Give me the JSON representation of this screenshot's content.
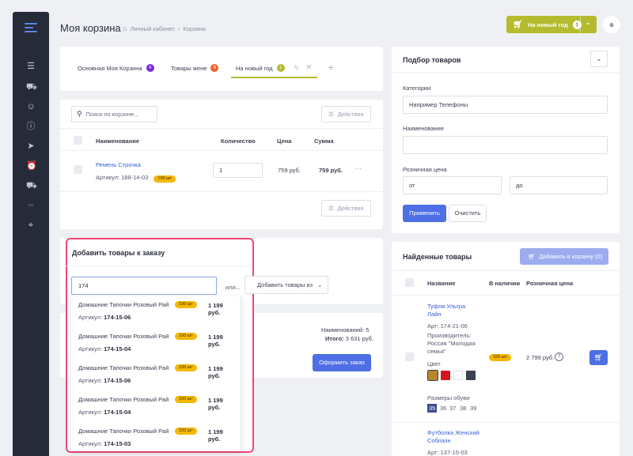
{
  "header": {
    "title": "Моя корзина",
    "breadcrumbs": [
      "Личный кабинет",
      "Корзина"
    ],
    "breadcrumb_sep": "›",
    "cart_button": {
      "label": "На новый год",
      "count": "1"
    }
  },
  "tabs": [
    {
      "label": "Основная Моя Корзина",
      "count": "4",
      "color": "#7b2ad9"
    },
    {
      "label": "Товары жене",
      "count": "6",
      "color": "#f0632b"
    },
    {
      "label": "На новый год",
      "count": "1",
      "color": "#b5bb2e"
    }
  ],
  "cart": {
    "search_placeholder": "Поиск по корзине...",
    "actions_label": "Действия",
    "columns": {
      "name": "Наименование",
      "qty": "Количество",
      "price": "Цена",
      "sum": "Сумма"
    },
    "items": [
      {
        "name": "Ремень Строчка",
        "article_label": "Артикул: 188-14-03",
        "stock": "100 шт",
        "qty": "1",
        "price": "759 руб.",
        "sum": "759 руб."
      }
    ]
  },
  "add_to_order": {
    "title": "Добавить товары к заказу",
    "search_value": "174",
    "or_label": "или...",
    "add_from_label": "Добавить товары из",
    "suggestions": [
      {
        "name": "Домашние Тапочки Розовый Рай",
        "stock": "100 шт",
        "price": "1 199 руб.",
        "article_prefix": "Артикул:",
        "article_match": "174",
        "article_rest": "-15-06"
      },
      {
        "name": "Домашние Тапочки Розовый Рай",
        "stock": "100 шт",
        "price": "1 199 руб.",
        "article_prefix": "Артикул:",
        "article_match": "174",
        "article_rest": "-15-04"
      },
      {
        "name": "Домашние Тапочки Розовый Рай",
        "stock": "100 шт",
        "price": "1 199 руб.",
        "article_prefix": "Артикул:",
        "article_match": "174",
        "article_rest": "-15-06"
      },
      {
        "name": "Домашние Тапочки Розовый Рай",
        "stock": "100 шт",
        "price": "1 199 руб.",
        "article_prefix": "Артикул:",
        "article_match": "174",
        "article_rest": "-15-04"
      },
      {
        "name": "Домашние Тапочки Розовый Рай",
        "stock": "100 шт",
        "price": "1 199 руб.",
        "article_prefix": "Артикул:",
        "article_match": "174",
        "article_rest": "-15-03"
      }
    ]
  },
  "summary": {
    "names_label": "Наименований:",
    "names_value": "5",
    "total_label": "Итого:",
    "total_value": "3 631 руб.",
    "order_button": "Оформить заказ"
  },
  "picker": {
    "title": "Подбор товаров",
    "category_label": "Категории",
    "category_placeholder": "Например Телефоны",
    "name_label": "Наименование",
    "price_label": "Розничная цена",
    "price_from": "от",
    "price_to": "до",
    "apply_label": "Применить",
    "clear_label": "Очистить"
  },
  "found": {
    "title": "Найденные товары",
    "add_button": "Добавить в корзину (0)",
    "columns": {
      "name": "Название",
      "stock": "В наличии",
      "price": "Розничная цена"
    },
    "product": {
      "name_line1": "Туфли Ультра",
      "name_line2": "Лайн",
      "article": "Арт: 174-21-06",
      "maker_label": "Производитель:",
      "maker_line1": "Россия \"Молодая",
      "maker_line2": "семья\"",
      "color_label": "Цвет",
      "colors": [
        "#b8862f",
        "#d8141c",
        "#ffffff",
        "#3b4252"
      ],
      "sizes_label": "Размеры обуви",
      "sizes": [
        "35",
        "36",
        "37",
        "38",
        "39"
      ],
      "stock": "100 шт",
      "price": "2 799 руб."
    },
    "product2": {
      "name_line1": "Футболка Женский",
      "name_line2": "Соблазн",
      "article": "Арт: 137-15-03"
    }
  }
}
